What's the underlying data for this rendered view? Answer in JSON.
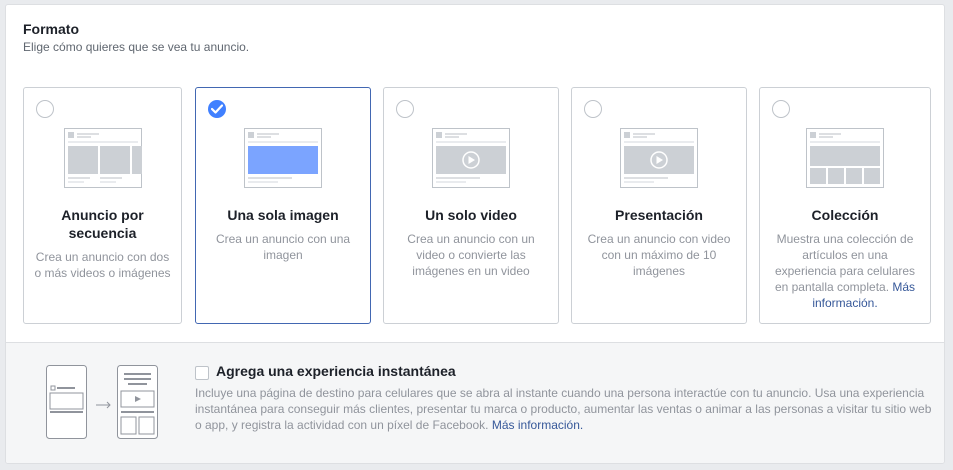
{
  "header": {
    "title": "Formato",
    "subtitle": "Elige cómo quieres que se vea tu anuncio."
  },
  "formats": [
    {
      "title": "Anuncio por secuencia",
      "description": "Crea un anuncio con dos o más videos o imágenes",
      "selected": false,
      "icon": "carousel-icon"
    },
    {
      "title": "Una sola imagen",
      "description": "Crea un anuncio con una imagen",
      "selected": true,
      "icon": "single-image-icon"
    },
    {
      "title": "Un solo video",
      "description": "Crea un anuncio con un video o convierte las imágenes en un video",
      "selected": false,
      "icon": "single-video-icon"
    },
    {
      "title": "Presentación",
      "description": "Crea un anuncio con video con un máximo de 10 imágenes",
      "selected": false,
      "icon": "slideshow-icon"
    },
    {
      "title": "Colección",
      "description": "Muestra una colección de artículos en una experiencia para celulares en pantalla completa.",
      "link": "Más información.",
      "selected": false,
      "icon": "collection-icon"
    }
  ],
  "instant_experience": {
    "checked": false,
    "title": "Agrega una experiencia instantánea",
    "description": "Incluye una página de destino para celulares que se abra al instante cuando una persona interactúe con tu anuncio. Usa una experiencia instantánea para conseguir más clientes, presentar tu marca o producto, aumentar las ventas o animar a las personas a visitar tu sitio web o app, y registra la actividad con un píxel de Facebook.",
    "link": "Más información."
  },
  "colors": {
    "accent": "#4267b2",
    "check": "#4080ff",
    "link": "#365899",
    "image_fill": "#7ba4ff"
  }
}
